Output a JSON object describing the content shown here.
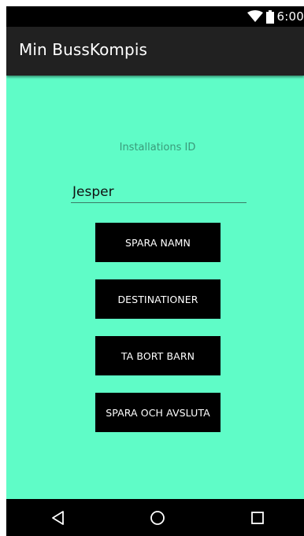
{
  "status_bar": {
    "time": "6:00",
    "icons": [
      "wifi-icon",
      "battery-icon"
    ]
  },
  "app_bar": {
    "title": "Min BussKompis"
  },
  "form": {
    "installation_label": "Installations ID",
    "name_value": "Jesper"
  },
  "buttons": {
    "save_name": "SPARA NAMN",
    "destinations": "DESTINATIONER",
    "remove_child": "TA BORT BARN",
    "save_and_exit": "SPARA OCH AVSLUTA"
  },
  "nav_bar": {
    "icons": [
      "back-icon",
      "home-icon",
      "recents-icon"
    ]
  },
  "colors": {
    "content_background": "#5ffcc7",
    "app_bar": "#212121",
    "button": "#000000",
    "label_text": "#3a9a7a"
  }
}
